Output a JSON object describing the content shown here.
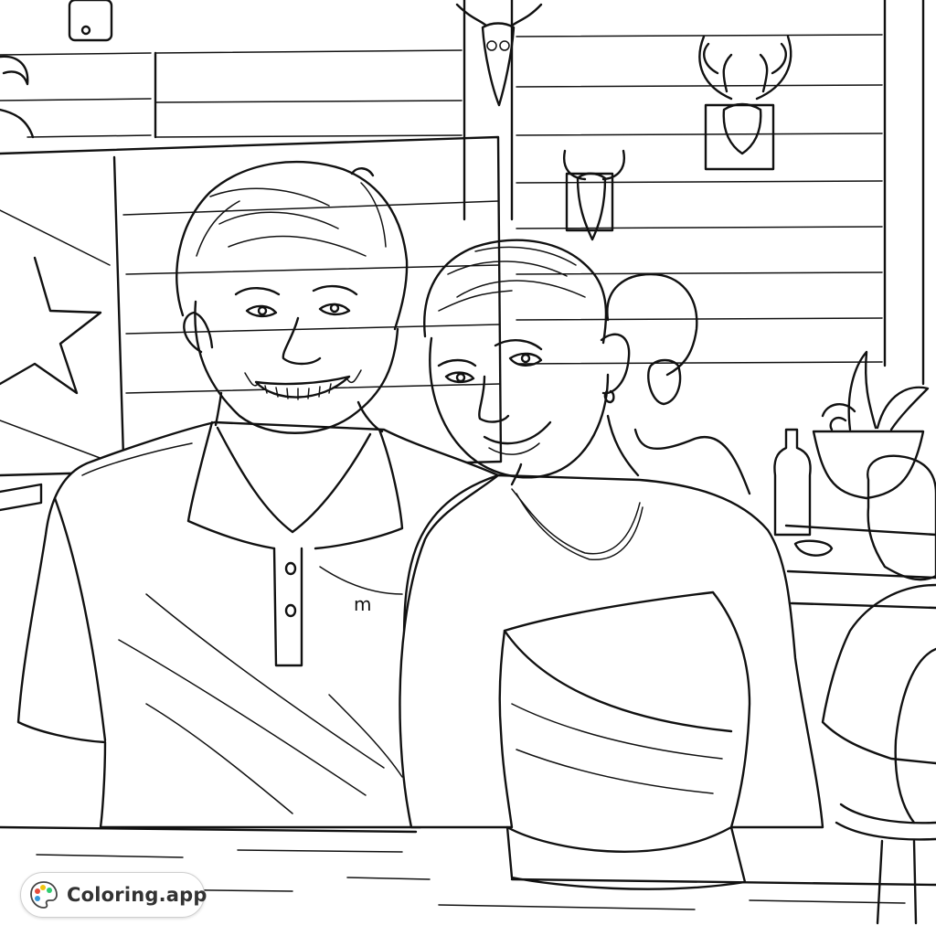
{
  "watermark": {
    "brand_text": "Coloring.app",
    "icon": "palette-icon",
    "palette_colors": [
      "#e74c3c",
      "#f1c40f",
      "#2ecc71",
      "#3498db"
    ]
  },
  "shirt": {
    "logo_letter": "m"
  },
  "colors": {
    "line": "#111111",
    "background": "#ffffff"
  }
}
